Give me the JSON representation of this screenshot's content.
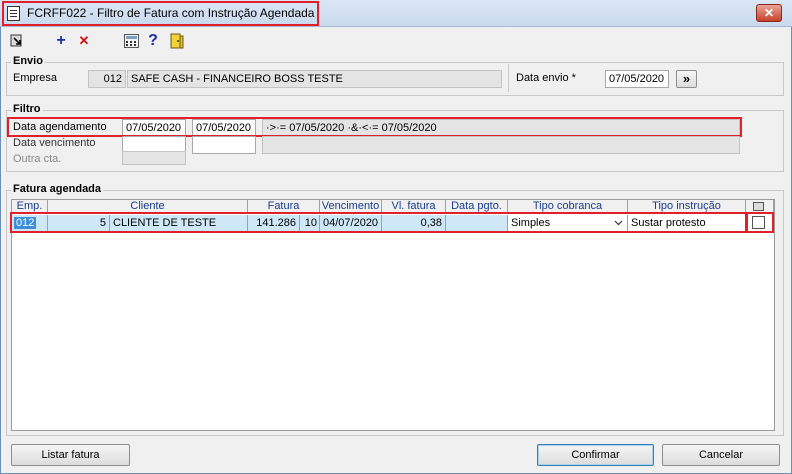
{
  "window": {
    "title": "FCRFF022 - Filtro de Fatura com Instrução Agendada",
    "close_glyph": "✕"
  },
  "toolbar": {
    "icons": [
      "exit-icon",
      "add-icon",
      "delete-icon",
      "calculator-icon",
      "help-icon",
      "door-icon"
    ],
    "add_glyph": "+",
    "delete_glyph": "✕",
    "help_glyph": "?"
  },
  "envio": {
    "legend": "Envio",
    "empresa_label": "Empresa",
    "empresa_code": "012",
    "empresa_name": "SAFE CASH - FINANCEIRO BOSS TESTE",
    "data_envio_label": "Data envio *",
    "data_envio_value": "07/05/2020",
    "next_button": "»"
  },
  "filtro": {
    "legend": "Filtro",
    "data_agendamento_label": "Data agendamento",
    "data_agendamento_from": "07/05/2020",
    "data_agendamento_to": "07/05/2020",
    "data_agendamento_expr": "·>·= 07/05/2020 ·&·<·= 07/05/2020",
    "data_vencimento_label": "Data vencimento",
    "data_vencimento_from": "",
    "data_vencimento_to": "",
    "outra_cta_label": "Outra cta."
  },
  "fatura": {
    "legend": "Fatura agendada",
    "columns": [
      "Emp.",
      "Cliente",
      "Fatura",
      "Vencimento",
      "Vl. fatura",
      "Data pgto.",
      "Tipo cobranca",
      "Tipo instrução"
    ],
    "rows": [
      {
        "emp": "012",
        "cliente_code": "5",
        "cliente_name": "CLIENTE DE TESTE",
        "fatura": "141.286",
        "fatura_seq": "10",
        "vencimento": "04/07/2020",
        "vl_fatura": "0,38",
        "data_pgto": "",
        "tipo_cobranca": "Simples",
        "tipo_instrucao": "Sustar protesto",
        "checked": false
      }
    ]
  },
  "footer": {
    "listar_label": "Listar fatura",
    "confirmar_label": "Confirmar",
    "cancelar_label": "Cancelar"
  },
  "colors": {
    "highlight": "#e0202a",
    "selection": "#3f8fd6",
    "row": "#cfe8f8"
  }
}
